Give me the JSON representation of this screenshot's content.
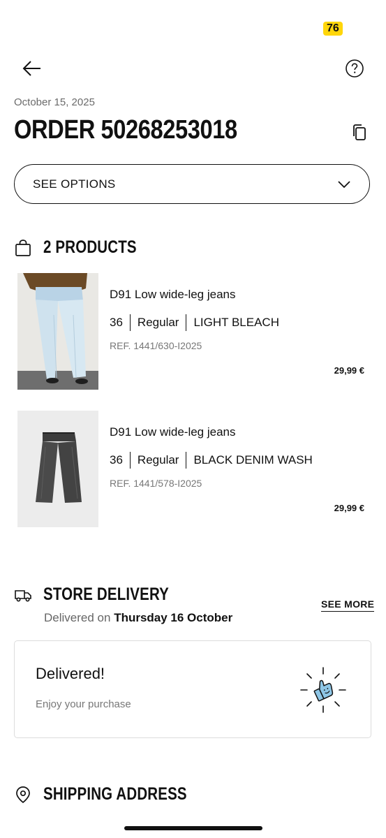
{
  "status_bar": {
    "badge": "76"
  },
  "header": {
    "back_icon": "arrow-left-icon",
    "help_icon": "question-circle-icon"
  },
  "order": {
    "date": "October 15, 2025",
    "title": "ORDER 50268253018",
    "copy_icon": "copy-icon",
    "options_label": "SEE OPTIONS"
  },
  "products": {
    "title": "2 PRODUCTS",
    "items": [
      {
        "name": "D91 Low wide-leg jeans",
        "size": "36",
        "fit": "Regular",
        "color": "LIGHT BLEACH",
        "ref": "REF. 1441/630-I2025",
        "price": "29,99 €"
      },
      {
        "name": "D91 Low wide-leg jeans",
        "size": "36",
        "fit": "Regular",
        "color": "BLACK DENIM WASH",
        "ref": "REF. 1441/578-I2025",
        "price": "29,99 €"
      }
    ]
  },
  "delivery": {
    "title": "STORE DELIVERY",
    "sub_prefix": "Delivered on",
    "sub_date": "Thursday 16 October",
    "see_more": "SEE MORE",
    "card_title": "Delivered!",
    "card_sub": "Enjoy your purchase"
  },
  "address": {
    "title": "SHIPPING ADDRESS"
  },
  "colors": {
    "badge": "#ffd60a",
    "light_denim": "#d7e6ef",
    "black_denim": "#3a3a3a"
  }
}
